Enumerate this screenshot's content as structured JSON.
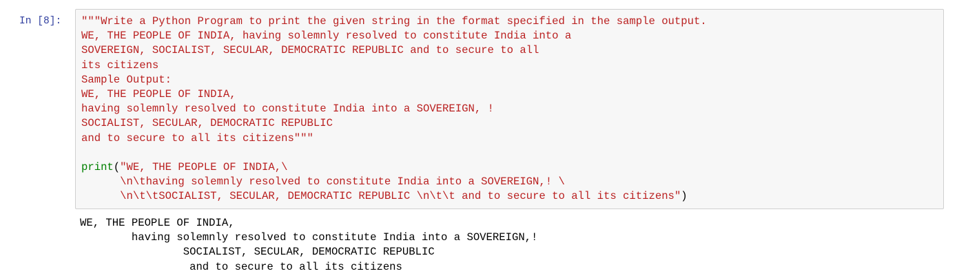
{
  "cell": {
    "prompt": "In [8]:",
    "docstring_lines": [
      "\"\"\"Write a Python Program to print the given string in the format specified in the sample output.",
      "WE, THE PEOPLE OF INDIA, having solemnly resolved to constitute India into a",
      "SOVEREIGN, SOCIALIST, SECULAR, DEMOCRATIC REPUBLIC and to secure to all",
      "its citizens",
      "Sample Output:",
      "WE, THE PEOPLE OF INDIA,",
      "having solemnly resolved to constitute India into a SOVEREIGN, !",
      "SOCIALIST, SECULAR, DEMOCRATIC REPUBLIC",
      "and to secure to all its citizens\"\"\""
    ],
    "print_keyword": "print",
    "open_paren": "(",
    "print_string_lines": [
      "\"WE, THE PEOPLE OF INDIA,\\",
      "      \\n\\thaving solemnly resolved to constitute India into a SOVEREIGN,! \\",
      "      \\n\\t\\tSOCIALIST, SECULAR, DEMOCRATIC REPUBLIC \\n\\t\\t and to secure to all its citizens\""
    ],
    "close_paren": ")"
  },
  "output_lines": [
    "WE, THE PEOPLE OF INDIA,",
    "        having solemnly resolved to constitute India into a SOVEREIGN,!",
    "                SOCIALIST, SECULAR, DEMOCRATIC REPUBLIC",
    "                 and to secure to all its citizens"
  ]
}
